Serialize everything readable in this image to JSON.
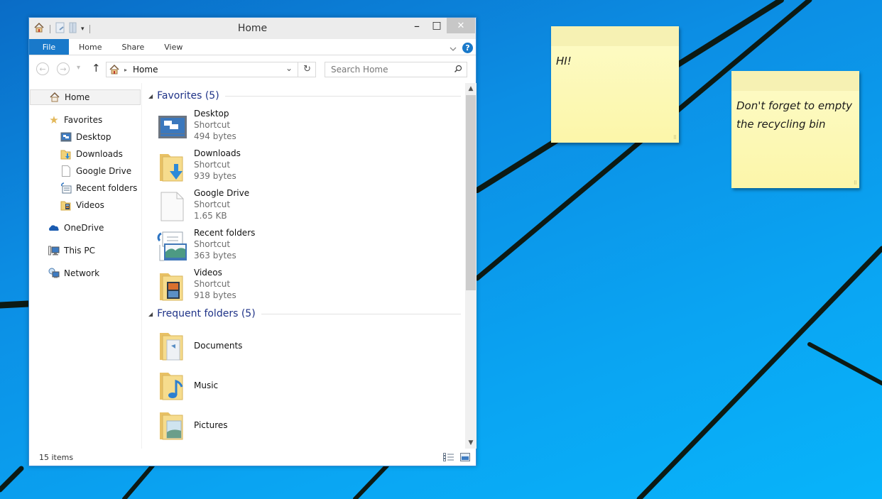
{
  "desktop": {
    "wallpaper": "windows-10-blue-lines"
  },
  "window": {
    "title": "Home",
    "quick_access_toolbar": [
      "home-icon",
      "properties-icon",
      "new-folder-icon",
      "customize-dropdown-icon"
    ],
    "controls": {
      "minimize": "–",
      "maximize": "□",
      "close": "✕"
    },
    "ribbon": {
      "tabs": [
        {
          "label": "File",
          "active": true
        },
        {
          "label": "Home"
        },
        {
          "label": "Share"
        },
        {
          "label": "View"
        }
      ],
      "expand_icon": "chevron-down-icon",
      "help_label": "?"
    },
    "navigation": {
      "back_icon": "←",
      "forward_icon": "→",
      "recent_icon": "▾",
      "up_icon": "↑",
      "address": {
        "breadcrumb_separator": "▸",
        "location": "Home",
        "dropdown_icon": "⌄",
        "refresh_icon": "↻"
      },
      "search": {
        "placeholder": "Search Home",
        "value": ""
      }
    },
    "nav_pane": {
      "home": {
        "label": "Home",
        "selected": true
      },
      "favorites": {
        "label": "Favorites",
        "items": [
          {
            "label": "Desktop",
            "icon": "desktop-icon"
          },
          {
            "label": "Downloads",
            "icon": "downloads-folder-icon"
          },
          {
            "label": "Google Drive",
            "icon": "file-icon"
          },
          {
            "label": "Recent folders",
            "icon": "recent-folders-icon"
          },
          {
            "label": "Videos",
            "icon": "videos-folder-icon"
          }
        ]
      },
      "onedrive": {
        "label": "OneDrive"
      },
      "this_pc": {
        "label": "This PC"
      },
      "network": {
        "label": "Network"
      }
    },
    "content": {
      "groups": [
        {
          "title": "Favorites (5)",
          "items": [
            {
              "name": "Desktop",
              "type": "Shortcut",
              "size": "494 bytes",
              "icon": "desktop-icon"
            },
            {
              "name": "Downloads",
              "type": "Shortcut",
              "size": "939 bytes",
              "icon": "downloads-folder-icon"
            },
            {
              "name": "Google Drive",
              "type": "Shortcut",
              "size": "1.65 KB",
              "icon": "file-icon"
            },
            {
              "name": "Recent folders",
              "type": "Shortcut",
              "size": "363 bytes",
              "icon": "recent-folders-icon"
            },
            {
              "name": "Videos",
              "type": "Shortcut",
              "size": "918 bytes",
              "icon": "videos-folder-icon"
            }
          ]
        },
        {
          "title": "Frequent folders (5)",
          "items": [
            {
              "name": "Documents",
              "icon": "documents-folder-icon"
            },
            {
              "name": "Music",
              "icon": "music-folder-icon"
            },
            {
              "name": "Pictures",
              "icon": "pictures-folder-icon"
            },
            {
              "name": "",
              "icon": "folder-icon"
            }
          ]
        }
      ]
    },
    "statusbar": {
      "item_count": "15 items",
      "views": [
        "details-view-icon",
        "large-icons-view-icon"
      ]
    }
  },
  "sticky_notes": [
    {
      "text": "HI!"
    },
    {
      "text": "Don't forget to empty the recycling bin"
    }
  ]
}
